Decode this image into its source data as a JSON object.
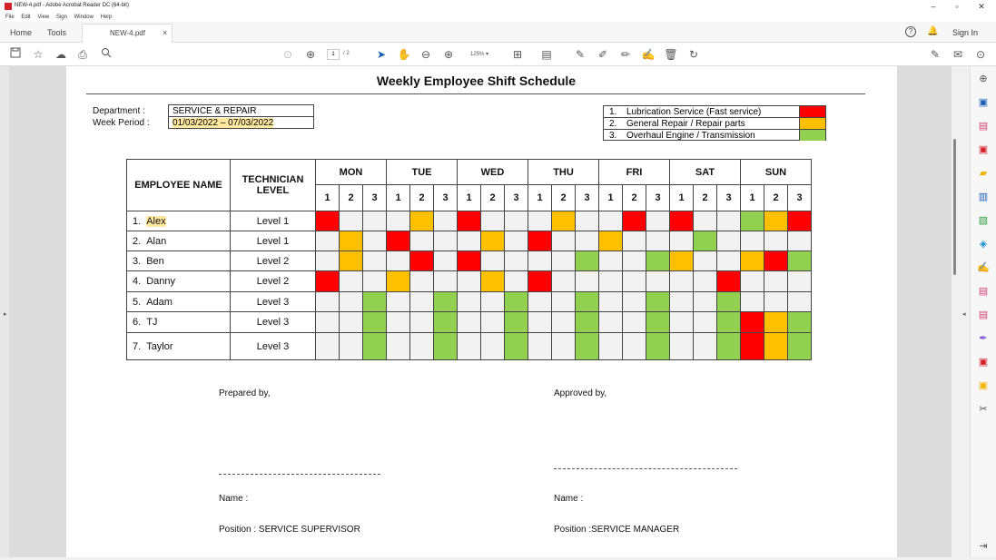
{
  "app": {
    "window_title": "NEW-4.pdf - Adobe Acrobat Reader DC (64-bit)",
    "menu": [
      "File",
      "Edit",
      "View",
      "Sign",
      "Window",
      "Help"
    ],
    "tabs": {
      "home": "Home",
      "tools": "Tools",
      "doc": "NEW-4.pdf",
      "close": "×"
    },
    "sign_in": "Sign In",
    "page_current": "1",
    "page_total": "/ 2",
    "zoom": "125%"
  },
  "document": {
    "title": "Weekly Employee Shift Schedule",
    "department_label": "Department :",
    "department_value": "SERVICE & REPAIR",
    "week_label": "Week Period :",
    "week_value": "01/03/2022 – 07/03/2022",
    "legend": [
      {
        "num": "1.",
        "text": "Lubrication Service (Fast service)",
        "color": "#ff0000"
      },
      {
        "num": "2.",
        "text": "General Repair / Repair parts",
        "color": "#ffc000"
      },
      {
        "num": "3.",
        "text": "Overhaul Engine / Transmission",
        "color": "#92d050"
      }
    ],
    "table": {
      "col_employee": "EMPLOYEE NAME",
      "col_level": "TECHNICIAN LEVEL",
      "days": [
        "MON",
        "TUE",
        "WED",
        "THU",
        "FRI",
        "SAT",
        "SUN"
      ],
      "shifts": [
        "1",
        "2",
        "3"
      ],
      "rows": [
        {
          "num": "1.",
          "name": "Alex",
          "level": "Level 1",
          "cells": [
            "r",
            "",
            "",
            "",
            "o",
            "",
            "r",
            "",
            "",
            "",
            "o",
            "",
            "",
            "r",
            "",
            "r",
            "",
            "",
            "g",
            "o",
            "r"
          ]
        },
        {
          "num": "2.",
          "name": "Alan",
          "level": "Level 1",
          "cells": [
            "",
            "o",
            "",
            "r",
            "",
            "",
            "",
            "o",
            "",
            "r",
            "",
            "",
            "o",
            "",
            "",
            "",
            "g",
            "",
            "",
            "",
            ""
          ]
        },
        {
          "num": "3.",
          "name": "Ben",
          "level": "Level 2",
          "cells": [
            "",
            "o",
            "",
            "",
            "r",
            "",
            "r",
            "",
            "",
            "",
            "",
            "g",
            "",
            "",
            "g",
            "o",
            "",
            "",
            "o",
            "r",
            "g"
          ]
        },
        {
          "num": "4.",
          "name": "Danny",
          "level": "Level 2",
          "cells": [
            "r",
            "",
            "",
            "o",
            "",
            "",
            "",
            "o",
            "",
            "r",
            "",
            "",
            "",
            "",
            "",
            "",
            "",
            "r",
            "",
            "",
            ""
          ]
        },
        {
          "num": "5.",
          "name": "Adam",
          "level": "Level 3",
          "cells": [
            "",
            "",
            "g",
            "",
            "",
            "g",
            "",
            "",
            "g",
            "",
            "",
            "g",
            "",
            "",
            "g",
            "",
            "",
            "g",
            "",
            "",
            ""
          ]
        },
        {
          "num": "6.",
          "name": "TJ",
          "level": "Level 3",
          "cells": [
            "",
            "",
            "g",
            "",
            "",
            "g",
            "",
            "",
            "g",
            "",
            "",
            "g",
            "",
            "",
            "g",
            "",
            "",
            "g",
            "r",
            "o",
            "g"
          ]
        },
        {
          "num": "7.",
          "name": "Taylor",
          "level": "Level 3",
          "cells": [
            "",
            "",
            "g",
            "",
            "",
            "g",
            "",
            "",
            "g",
            "",
            "",
            "g",
            "",
            "",
            "g",
            "",
            "",
            "g",
            "r",
            "o",
            "g"
          ]
        }
      ]
    },
    "signatures": {
      "prepared_by": "Prepared by,",
      "approved_by": "Approved by,",
      "name_left": "Name :",
      "name_right": "Name :",
      "position_left": "Position : SERVICE SUPERVISOR",
      "position_right": "Position :SERVICE MANAGER"
    }
  }
}
